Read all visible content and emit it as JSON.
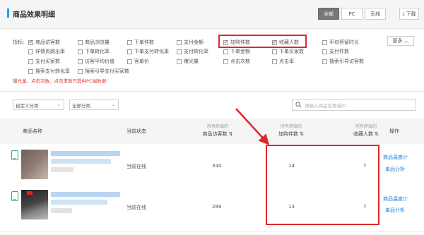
{
  "header": {
    "title": "商品效果明细",
    "tabs": [
      {
        "label": "全部",
        "active": true
      },
      {
        "label": "PC",
        "active": false
      },
      {
        "label": "无线",
        "active": false
      }
    ],
    "download_label": "下载"
  },
  "metrics": {
    "label": "指标:",
    "more_label": "更多",
    "items": [
      {
        "label": "商品访客数",
        "checked": true
      },
      {
        "label": "商品浏览量",
        "checked": false
      },
      {
        "label": "下单件数",
        "checked": false
      },
      {
        "label": "支付金额",
        "checked": false
      },
      {
        "label": "加购件数",
        "checked": true
      },
      {
        "label": "收藏人数",
        "checked": true
      },
      {
        "label": "平均停留时长",
        "checked": false
      },
      {
        "label": "详情页跳出率",
        "checked": false
      },
      {
        "label": "下单转化率",
        "checked": false
      },
      {
        "label": "下单支付转化率",
        "checked": false
      },
      {
        "label": "支付转化率",
        "checked": false
      },
      {
        "label": "下单金额",
        "checked": false
      },
      {
        "label": "下单买家数",
        "checked": false
      },
      {
        "label": "支付件数",
        "checked": false
      },
      {
        "label": "支付买家数",
        "checked": false
      },
      {
        "label": "访客平均价值",
        "checked": false
      },
      {
        "label": "客单价",
        "checked": false
      },
      {
        "label": "曝光量",
        "checked": false
      },
      {
        "label": "点击次数",
        "checked": false
      },
      {
        "label": "点击率",
        "checked": false
      },
      {
        "label": "搜索引导访客数",
        "checked": false
      },
      {
        "label": "搜索支付转化率",
        "checked": false
      },
      {
        "label": "搜索引导支付买家数",
        "checked": false
      }
    ],
    "note": "曝光量、点击次数、点击率暂只提供PC端数据!"
  },
  "filters": {
    "category_label": "自定义分类",
    "all_category_label": "全部分类",
    "search_placeholder": "请输入商品名称或ID"
  },
  "table": {
    "columns": [
      {
        "label": "商品名称",
        "sub": ""
      },
      {
        "label": "当前状态",
        "sub": ""
      },
      {
        "label": "商品访客数",
        "sub": "所有终端的"
      },
      {
        "label": "加购件数",
        "sub": "所有终端的"
      },
      {
        "label": "收藏人数",
        "sub": "所有终端的"
      },
      {
        "label": "操作",
        "sub": ""
      }
    ],
    "rows": [
      {
        "status": "当前在线",
        "visitors": "344",
        "cart": "14",
        "fav": "7",
        "action1": "商品温度计",
        "action2": "单品分析"
      },
      {
        "status": "当前在线",
        "visitors": "289",
        "cart": "13",
        "fav": "7",
        "action1": "商品温度计",
        "action2": "单品分析"
      }
    ]
  },
  "colors": {
    "accent": "#1ea3ff",
    "highlight": "#e0262b",
    "link": "#1a7ed6"
  }
}
